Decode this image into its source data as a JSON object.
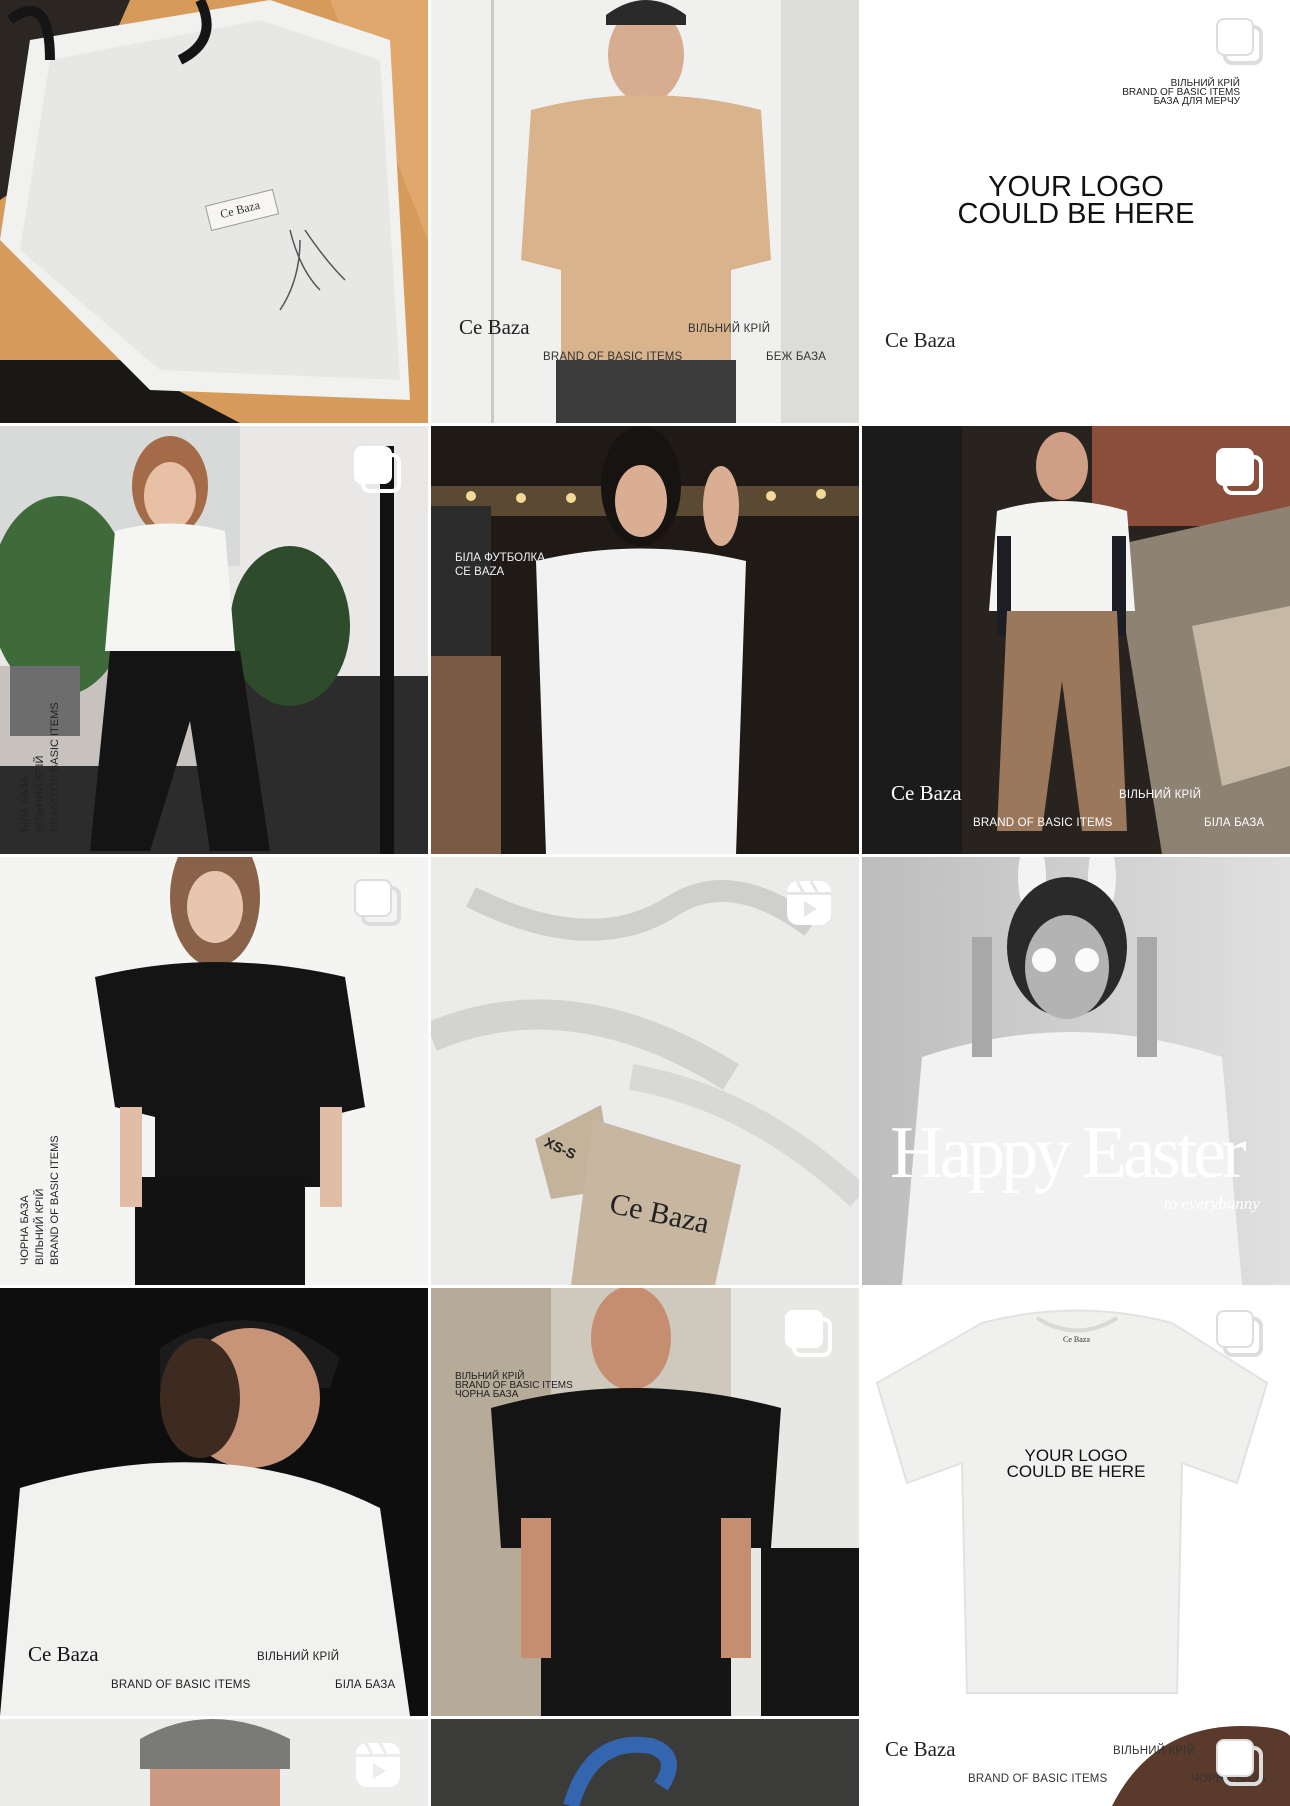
{
  "posts": [
    {
      "row": 0,
      "col": 0,
      "kind": "photo",
      "subject": "tote-bag",
      "label": "Ce Baza"
    },
    {
      "row": 0,
      "col": 1,
      "kind": "photo",
      "subject": "man-beige-tee",
      "logo": "Ce Baza",
      "tagline": "BRAND OF BASIC ITEMS",
      "cut": "ВІЛЬНИЙ КРІЙ",
      "color": "БЕЖ БАЗА"
    },
    {
      "row": 0,
      "col": 2,
      "kind": "carousel",
      "subject": "logo-placeholder",
      "top_lines": [
        "ВІЛЬНИЙ КРІЙ",
        "BRAND OF BASIC ITEMS",
        "БАЗА ДЛЯ МЕРЧУ"
      ],
      "big_lines": [
        "YOUR LOGO",
        "COULD BE HERE"
      ],
      "logo": "Ce Baza"
    },
    {
      "row": 1,
      "col": 0,
      "kind": "carousel",
      "subject": "woman-white-tee-plants",
      "vertical_lines": [
        "БІЛА БАЗА",
        "ВІЛЬНИЙ КРІЙ",
        "BRAND OF BASIC ITEMS"
      ]
    },
    {
      "row": 1,
      "col": 1,
      "kind": "photo",
      "subject": "woman-white-tee-night",
      "lines": [
        "БІЛА ФУТБОЛКА",
        "CE BAZA"
      ]
    },
    {
      "row": 1,
      "col": 2,
      "kind": "carousel",
      "subject": "man-white-tee-layered",
      "logo": "Ce Baza",
      "tagline": "BRAND OF BASIC ITEMS",
      "cut": "ВІЛЬНИЙ КРІЙ",
      "color": "БІЛА БАЗА"
    },
    {
      "row": 2,
      "col": 0,
      "kind": "carousel",
      "subject": "woman-black-tee",
      "vertical_lines": [
        "ЧОРНА БАЗА",
        "ВІЛЬНИЙ КРІЙ",
        "BRAND OF BASIC ITEMS"
      ]
    },
    {
      "row": 2,
      "col": 1,
      "kind": "reel",
      "subject": "label-closeup",
      "size": "XS-S",
      "label": "Ce Baza"
    },
    {
      "row": 2,
      "col": 2,
      "kind": "photo",
      "subject": "happy-easter",
      "headline": "Happy Easter",
      "subline": "to everybunny"
    },
    {
      "row": 3,
      "col": 0,
      "kind": "photo",
      "subject": "man-back-white-tee",
      "logo": "Ce Baza",
      "tagline": "BRAND OF BASIC ITEMS",
      "cut": "ВІЛЬНИЙ КРІЙ",
      "color": "БІЛА БАЗА"
    },
    {
      "row": 3,
      "col": 1,
      "kind": "carousel",
      "subject": "man-black-tee",
      "lines": [
        "ВІЛЬНИЙ КРІЙ",
        "BRAND OF BASIC ITEMS",
        "ЧОРНА БАЗА"
      ]
    },
    {
      "row": 3,
      "col": 2,
      "kind": "carousel",
      "subject": "tee-logo-mock",
      "big_lines": [
        "YOUR LOGO",
        "COULD BE HERE"
      ],
      "neck_label": "Ce Baza"
    },
    {
      "row": 4,
      "col": 0,
      "kind": "reel",
      "subject": "man-beanie"
    },
    {
      "row": 4,
      "col": 1,
      "kind": "photo",
      "subject": "blue-hanger"
    },
    {
      "row": 4,
      "col": 2,
      "kind": "carousel",
      "subject": "hat-promo",
      "logo": "Ce Baza",
      "tagline": "BRAND OF BASIC ITEMS",
      "cut": "ВІЛЬНИЙ КРІЙ",
      "color": "ЧОРНА БАЗА"
    }
  ],
  "icons": {
    "carousel": "carousel-icon",
    "reel": "reels-icon"
  }
}
